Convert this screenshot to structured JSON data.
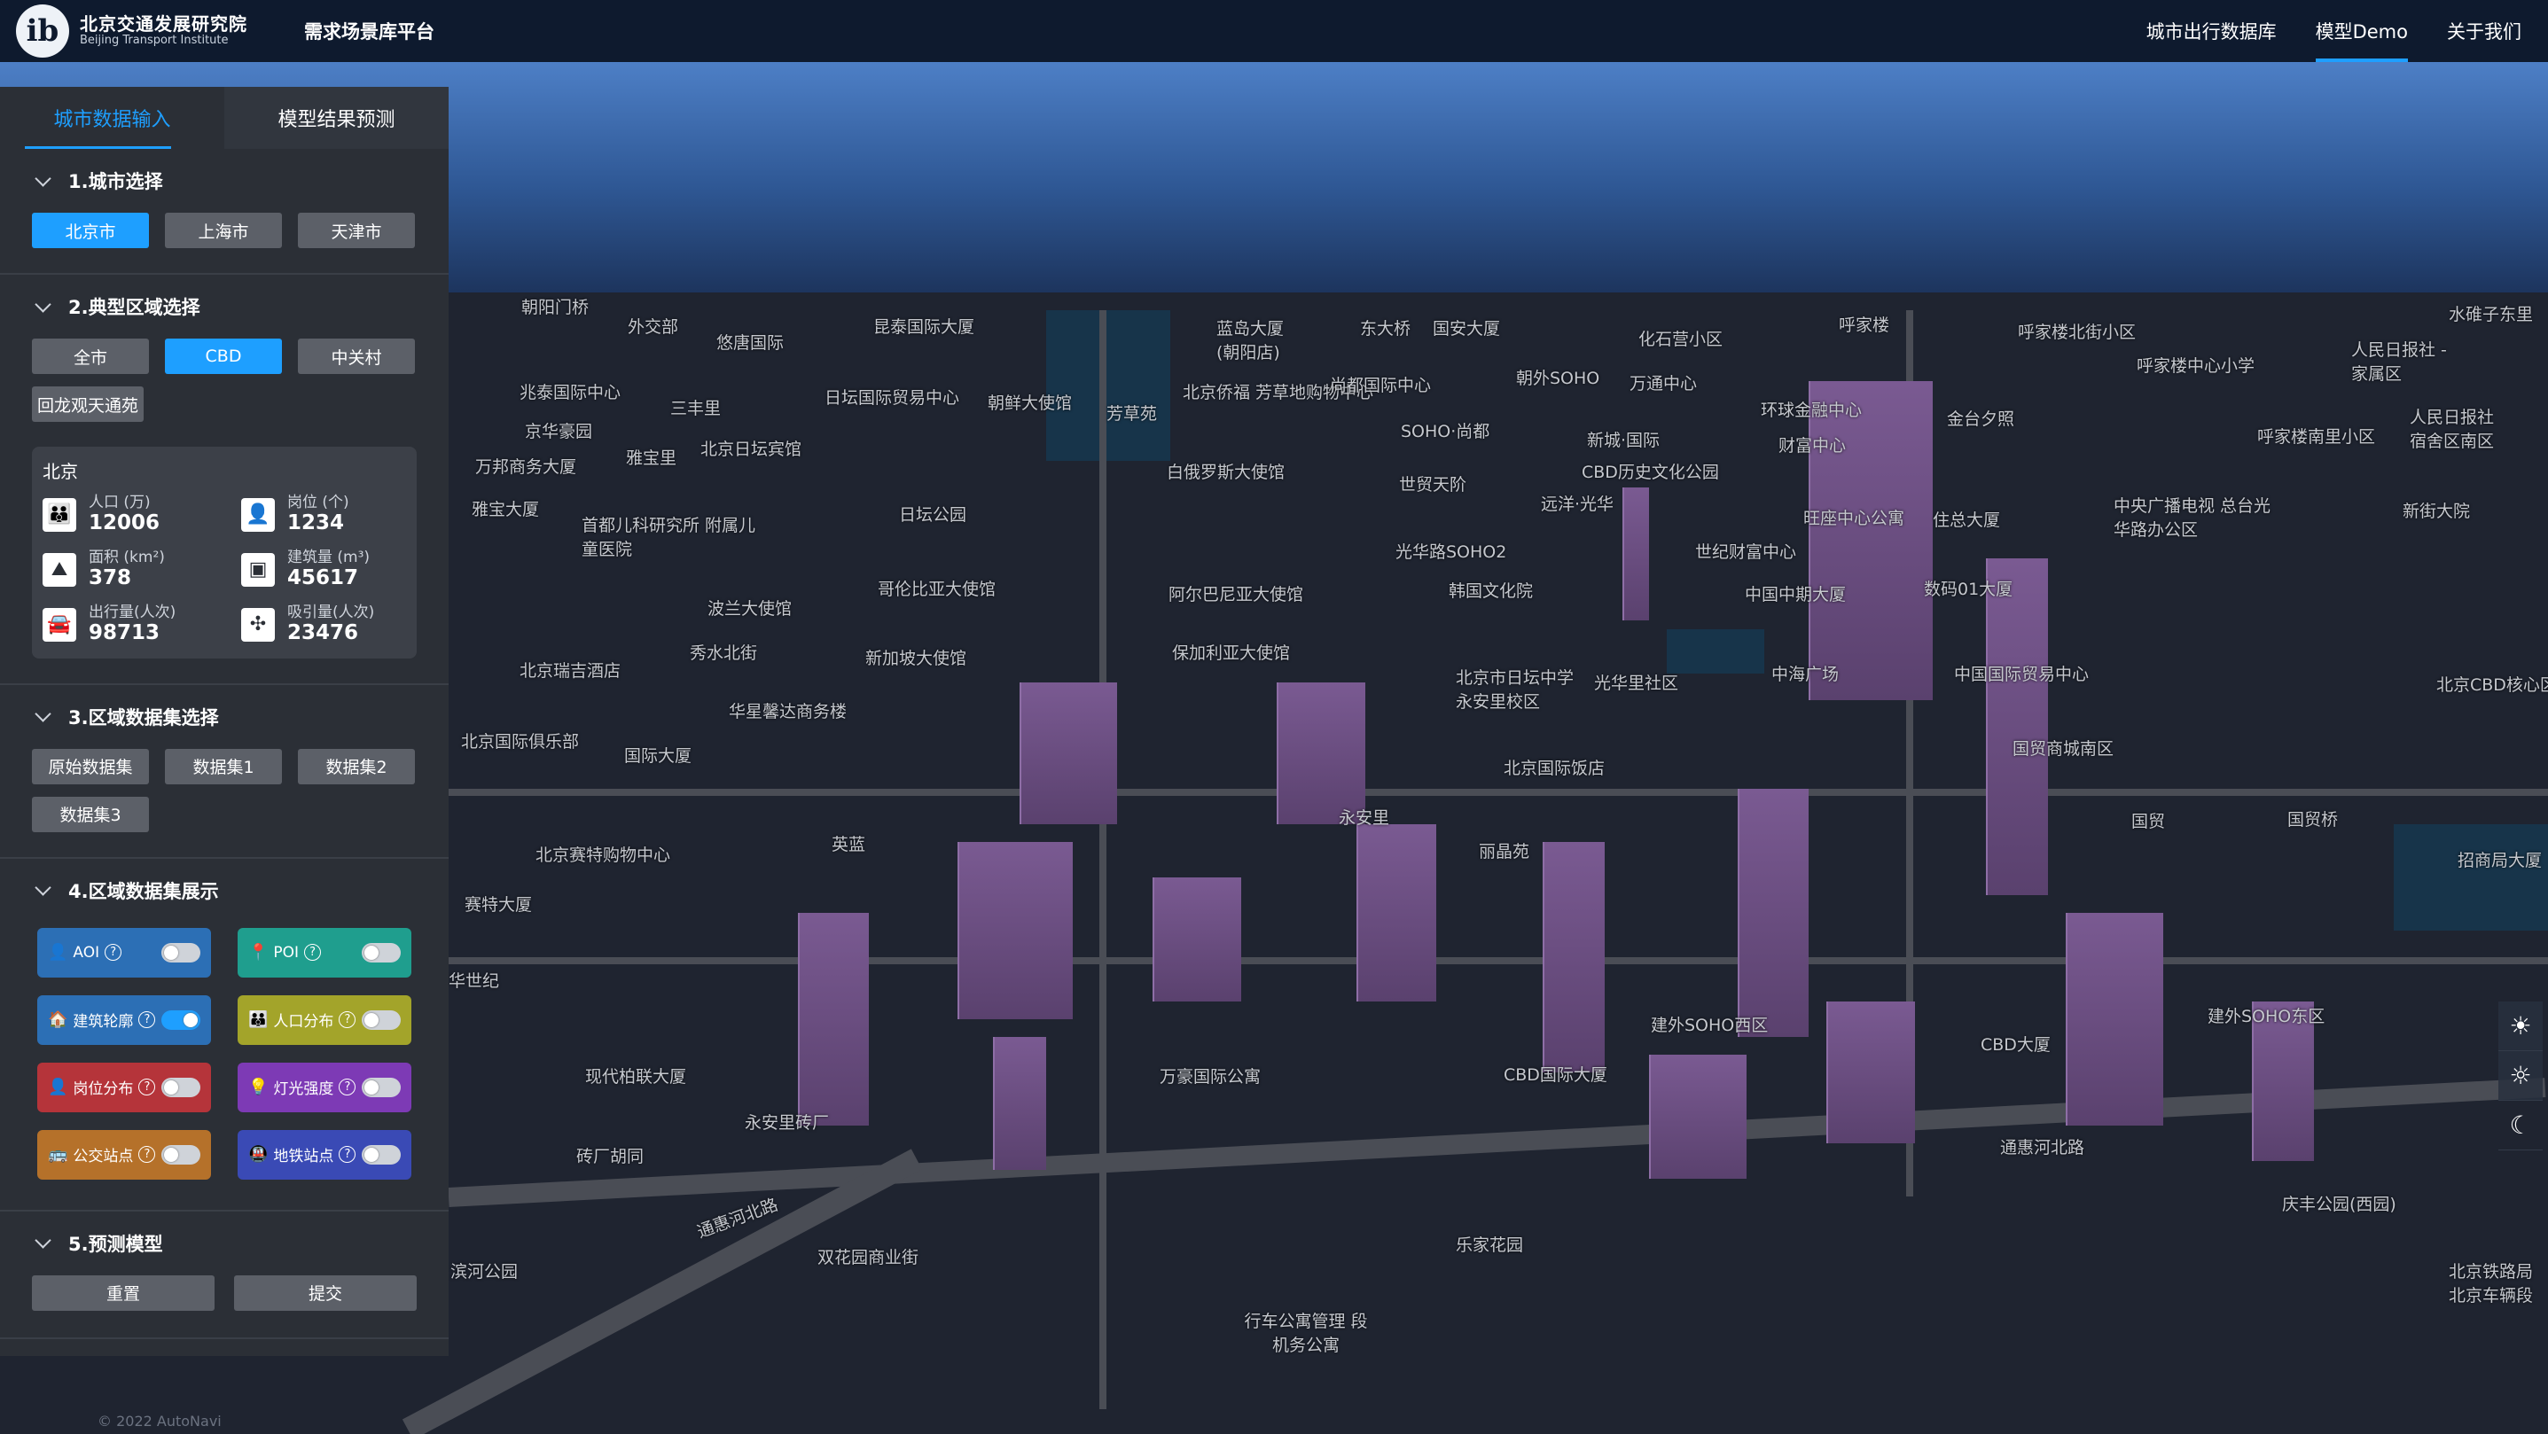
{
  "header": {
    "logo_mark": "ib",
    "logo_cn": "北京交通发展研究院",
    "logo_en": "Beijing Transport Institute",
    "platform_title": "需求场景库平台",
    "nav": [
      {
        "label": "城市出行数据库",
        "active": false
      },
      {
        "label": "模型Demo",
        "active": true
      },
      {
        "label": "关于我们",
        "active": false
      }
    ]
  },
  "panel": {
    "tabs": [
      {
        "label": "城市数据输入",
        "active": true
      },
      {
        "label": "模型结果预测",
        "active": false
      }
    ],
    "city_section": {
      "title": "1.城市选择",
      "options": [
        "北京市",
        "上海市",
        "天津市"
      ],
      "selected": "北京市"
    },
    "region_section": {
      "title": "2.典型区域选择",
      "options": [
        "全市",
        "CBD",
        "中关村",
        "回龙观天通苑"
      ],
      "selected": "CBD",
      "stats_title": "北京",
      "stats": [
        {
          "icon": "population-icon",
          "label": "人口 (万)",
          "value": "12006"
        },
        {
          "icon": "jobs-icon",
          "label": "岗位 (个)",
          "value": "1234"
        },
        {
          "icon": "area-icon",
          "label": "面积 (km²)",
          "value": "378"
        },
        {
          "icon": "building-volume-icon",
          "label": "建筑量 (m³)",
          "value": "45617"
        },
        {
          "icon": "trips-out-icon",
          "label": "出行量(人次)",
          "value": "98713"
        },
        {
          "icon": "attraction-icon",
          "label": "吸引量(人次)",
          "value": "23476"
        }
      ]
    },
    "dataset_section": {
      "title": "3.区域数据集选择",
      "options": [
        "原始数据集",
        "数据集1",
        "数据集2",
        "数据集3"
      ]
    },
    "display_section": {
      "title": "4.区域数据集展示",
      "layers": [
        {
          "label": "AOI",
          "icon": "person-icon",
          "color": "#2c6fb5",
          "on": false
        },
        {
          "label": "POI",
          "icon": "location-pin-icon",
          "color": "#1f9e8e",
          "on": false
        },
        {
          "label": "建筑轮廓",
          "icon": "building-icon",
          "color": "#2c6fb5",
          "on": true
        },
        {
          "label": "人口分布",
          "icon": "population-icon",
          "color": "#a3a42a",
          "on": false
        },
        {
          "label": "岗位分布",
          "icon": "person-icon",
          "color": "#b5343a",
          "on": false
        },
        {
          "label": "灯光强度",
          "icon": "bulb-icon",
          "color": "#7d3ab5",
          "on": false
        },
        {
          "label": "公交站点",
          "icon": "bus-icon",
          "color": "#b5712a",
          "on": false
        },
        {
          "label": "地铁站点",
          "icon": "subway-icon",
          "color": "#3a4ab5",
          "on": false
        }
      ]
    },
    "model_section": {
      "title": "5.预测模型",
      "reset_label": "重置",
      "submit_label": "提交"
    }
  },
  "map": {
    "labels": [
      "朝阳门桥",
      "外交部",
      "悠唐国际",
      "昆泰国际大厦",
      "蓝岛大厦 (朝阳店)",
      "东大桥",
      "国安大厦",
      "化石营小区",
      "呼家楼",
      "呼家楼北街小区",
      "人民日报社 -家属区",
      "水碓子东里",
      "兆泰国际中心",
      "三丰里",
      "日坛国际贸易中心",
      "朝鲜大使馆",
      "芳草苑",
      "北京侨福 芳草地购物中心",
      "尚都国际中心",
      "朝外SOHO",
      "万通中心",
      "呼家楼中心小学",
      "京华豪园",
      "雅宝里",
      "北京日坛宾馆",
      "SOHO·尚都",
      "新城·国际",
      "环球金融中心",
      "金台夕照",
      "呼家楼南里小区",
      "人民日报社 宿舍区南区",
      "万邦商务大厦",
      "白俄罗斯大使馆",
      "世贸天阶",
      "CBD历史文化公园",
      "财富中心",
      "雅宝大厦",
      "首都儿科研究所 附属儿童医院",
      "日坛公园",
      "远洋·光华",
      "旺座中心公寓",
      "住总大厦",
      "中央广播电视 总台光华路办公区",
      "新街大院",
      "光华路SOHO2",
      "世纪财富中心",
      "哥伦比亚大使馆",
      "阿尔巴尼亚大使馆",
      "韩国文化院",
      "数码01大厦",
      "波兰大使馆",
      "秀水北街",
      "新加坡大使馆",
      "保加利亚大使馆",
      "中国中期大厦",
      "北京瑞吉酒店",
      "华星馨达商务楼",
      "北京市日坛中学 永安里校区",
      "光华里社区",
      "中海广场",
      "中国国际贸易中心",
      "北京CBD核心区",
      "北京国际俱乐部",
      "国际大厦",
      "永安里",
      "北京国际饭店",
      "国贸商城南区",
      "国贸桥",
      "北京赛特购物中心",
      "丽晶苑",
      "国贸",
      "赛特大厦",
      "英蓝",
      "建外SOHO西区",
      "建外SOHO东区",
      "华世纪",
      "现代柏联大厦",
      "万豪国际公寓",
      "CBD国际大厦",
      "CBD大厦",
      "永安里砖厂",
      "砖厂胡同",
      "通惠河北路",
      "庆丰公园(西园)",
      "滨河公园",
      "双花园商业街",
      "乐家花园",
      "行车公寓管理 段机务公寓",
      "北京铁路局 北京车辆段",
      "招商局大厦",
      "通惠河北路"
    ],
    "copyright": "© 2022 AutoNavi"
  }
}
